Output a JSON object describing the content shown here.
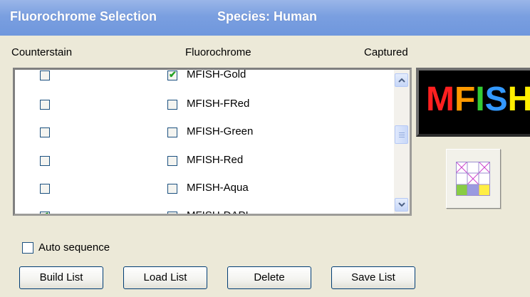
{
  "header": {
    "title": "Fluorochrome Selection",
    "species": "Species: Human"
  },
  "columns": {
    "counterstain": "Counterstain",
    "fluorochrome": "Fluorochrome",
    "captured": "Captured"
  },
  "rows": [
    {
      "counterstain_checked": false,
      "fluorochrome_checked": true,
      "label": "MFISH-Gold"
    },
    {
      "counterstain_checked": false,
      "fluorochrome_checked": false,
      "label": "MFISH-FRed"
    },
    {
      "counterstain_checked": false,
      "fluorochrome_checked": false,
      "label": "MFISH-Green"
    },
    {
      "counterstain_checked": false,
      "fluorochrome_checked": false,
      "label": "MFISH-Red"
    },
    {
      "counterstain_checked": false,
      "fluorochrome_checked": false,
      "label": "MFISH-Aqua"
    },
    {
      "counterstain_checked": true,
      "fluorochrome_checked": false,
      "label": "MFISH-DAPI"
    }
  ],
  "logo": {
    "letters": [
      {
        "char": "M",
        "color": "#ff2020"
      },
      {
        "char": "F",
        "color": "#ff9900"
      },
      {
        "char": "I",
        "color": "#33cc33"
      },
      {
        "char": "S",
        "color": "#3399ff"
      },
      {
        "char": "H",
        "color": "#ffee00"
      }
    ]
  },
  "auto_sequence": {
    "label": "Auto sequence",
    "checked": false
  },
  "buttons": {
    "build": "Build List",
    "load": "Load List",
    "delete": "Delete",
    "save": "Save List"
  },
  "colors": {
    "title_bar": "#7a9fe0",
    "dialog_bg": "#ece9d8",
    "check_green": "#21a121"
  }
}
